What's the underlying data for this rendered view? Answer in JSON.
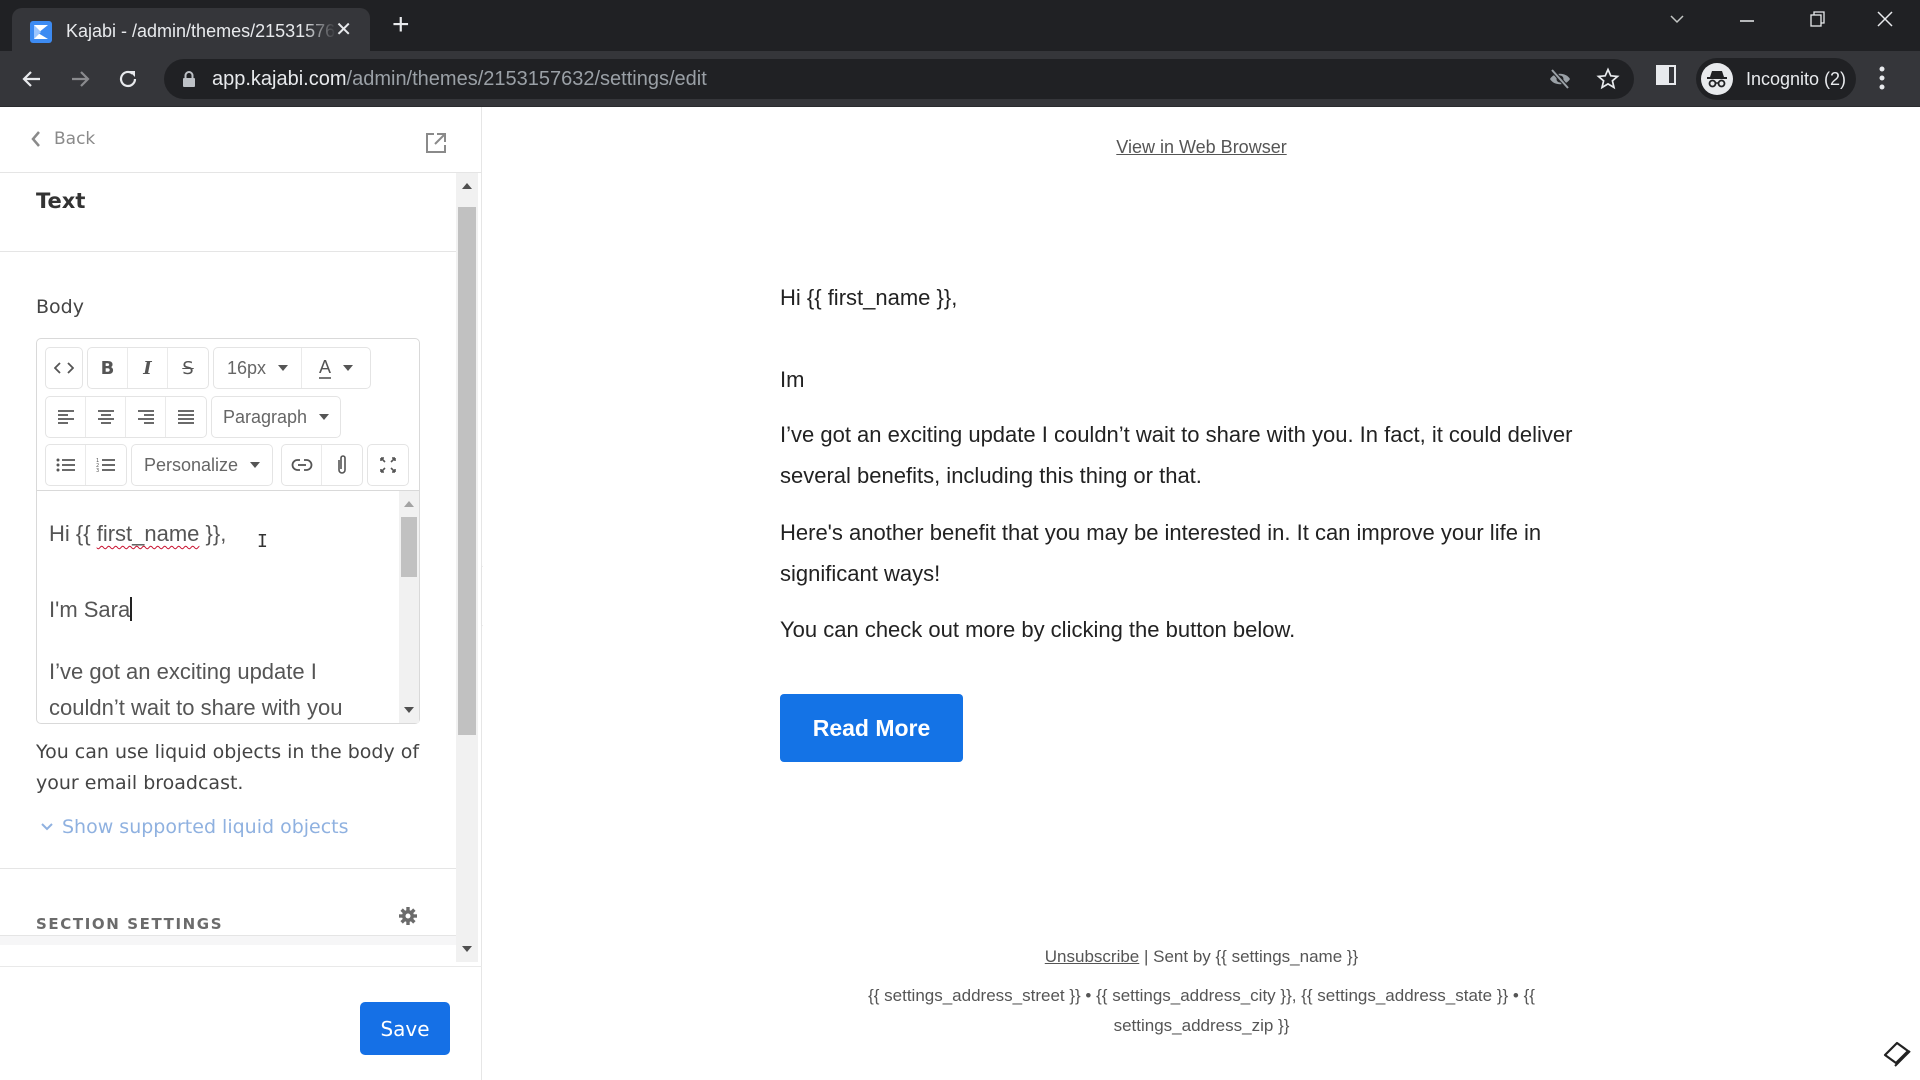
{
  "browser": {
    "tab_title": "Kajabi - /admin/themes/2153157632/settings/edit",
    "url_host": "app.kajabi.com",
    "url_path": "/admin/themes/2153157632/settings/edit",
    "profile_label": "Incognito (2)"
  },
  "panel": {
    "back_label": "Back",
    "section_title": "Text",
    "body_label": "Body",
    "toolbar": {
      "font_size": "16px",
      "block_format": "Paragraph",
      "personalize": "Personalize"
    },
    "editor_content": {
      "greeting_prefix": "Hi {{ ",
      "greeting_var": "first_name",
      "greeting_suffix": " }},",
      "line2": "I'm Sara",
      "line3a": "I’ve got an exciting update I",
      "line3b": "couldn’t wait to share with you"
    },
    "help_text": "You can use liquid objects in the body of your email broadcast.",
    "liquid_link": "Show supported liquid objects",
    "section_settings_label": "SECTION SETTINGS",
    "save_label": "Save"
  },
  "preview": {
    "view_in_browser": "View in Web Browser",
    "paragraphs": [
      "Hi {{ first_name }},",
      "Im",
      "I’ve got an exciting update I couldn’t wait to share with you. In fact, it could deliver several benefits, including this thing or that.",
      "Here's another benefit that you may be interested in. It can improve your life in significant ways!",
      "You can check out more by clicking the button below."
    ],
    "button_label": "Read More",
    "footer": {
      "unsubscribe": "Unsubscribe",
      "sent_by": " | Sent by {{ settings_name }}",
      "address": "{{ settings_address_street }} • {{ settings_address_city }}, {{ settings_address_state }} • {{ settings_address_zip }}"
    }
  },
  "colors": {
    "primary": "#1570e6",
    "link_muted": "#8fb1e0",
    "chrome_dark": "#202124"
  }
}
